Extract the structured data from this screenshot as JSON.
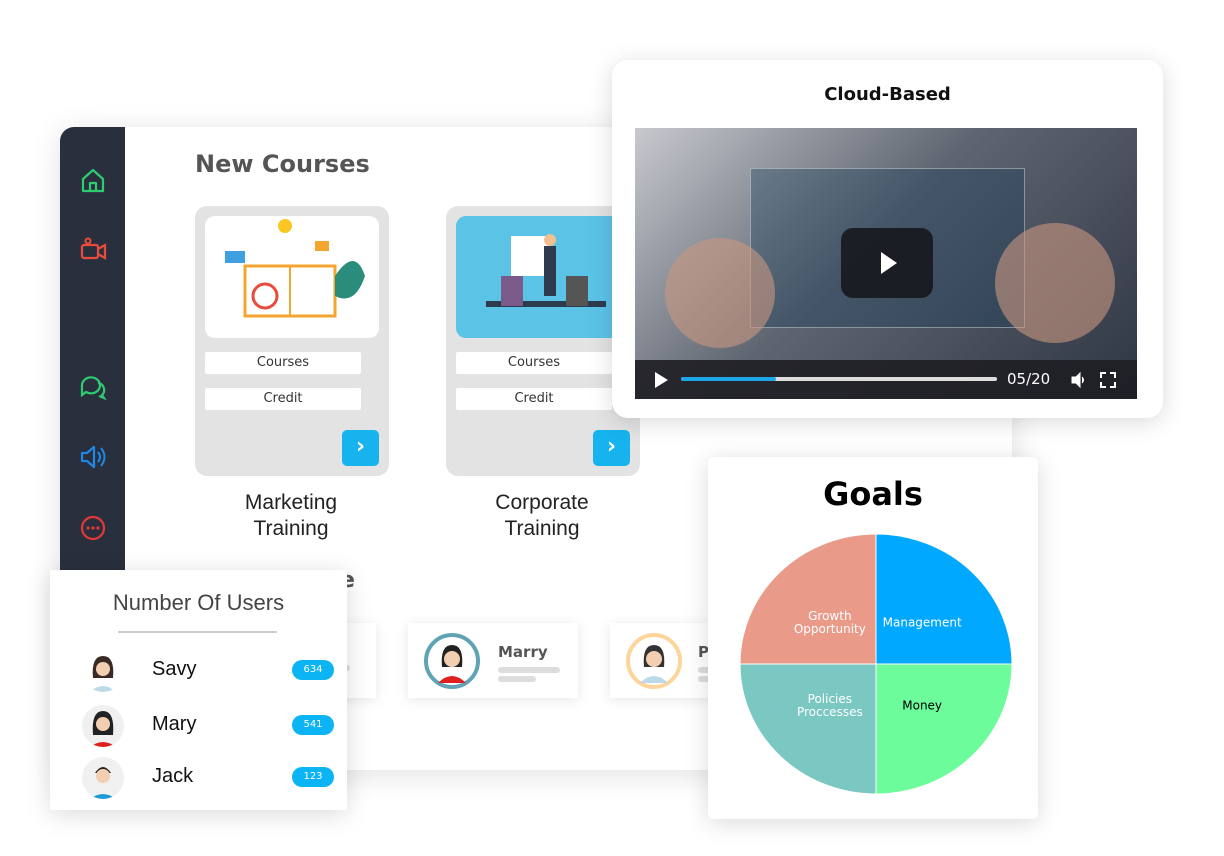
{
  "sidebar": {
    "icons": [
      "home-icon",
      "video-camera-icon",
      "chat-icon",
      "speaker-icon",
      "more-icon"
    ],
    "colors": {
      "home": "#2ecc71",
      "video": "#e74c3c",
      "chat": "#2ecc71",
      "speaker": "#1e88e5",
      "more": "#e53935"
    }
  },
  "courses": {
    "title": "New Courses",
    "items": [
      {
        "name": "Marketing Training",
        "line1": "Marketing",
        "line2": "Training",
        "courses_label": "Courses",
        "credit_label": "Credit"
      },
      {
        "name": "Corporate Training",
        "line1": "Corporate",
        "line2": "Training",
        "courses_label": "Courses",
        "credit_label": "Credit"
      }
    ]
  },
  "profiles": {
    "section_title_fragment": "e",
    "items": [
      {
        "name": "Marry"
      },
      {
        "name": "P"
      }
    ]
  },
  "video": {
    "title": "Cloud-Based",
    "time": "05/20",
    "progress": 0.3
  },
  "users": {
    "title": "Number Of Users",
    "items": [
      {
        "name": "Savy",
        "count": "634"
      },
      {
        "name": "Mary",
        "count": "541"
      },
      {
        "name": "Jack",
        "count": "123"
      }
    ]
  },
  "goals": {
    "title": "Goals",
    "accent": "#00a8ff"
  },
  "chart_data": {
    "type": "pie",
    "title": "Goals",
    "categories": [
      "Management",
      "Money",
      "Policies Proccesses",
      "Growth Opportunity"
    ],
    "values": [
      25,
      25,
      25,
      25
    ],
    "colors": [
      "#00a8ff",
      "#6dfc9b",
      "#7bc8c2",
      "#ea9a88"
    ]
  }
}
